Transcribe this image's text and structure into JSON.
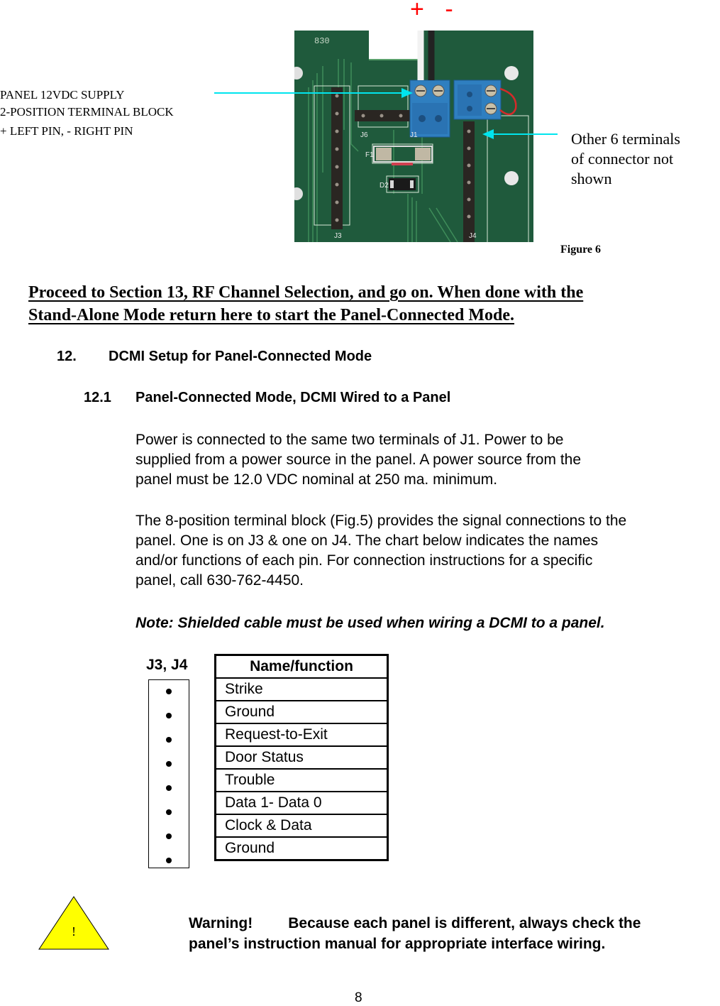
{
  "figure": {
    "polarity_plus": "+",
    "polarity_minus": "-",
    "callout_left": [
      "PANEL 12VDC SUPPLY",
      "2-POSITION TERMINAL BLOCK",
      "+ LEFT PIN, - RIGHT PIN"
    ],
    "callout_right": [
      "Other 6 terminals",
      "of connector not",
      "shown"
    ],
    "caption": "Figure 6",
    "board_labels": {
      "j3": "J3",
      "j4": "J4",
      "j6": "J6",
      "j1": "J1",
      "f1": "F1",
      "d2": "D2",
      "board_id": "830"
    },
    "colors": {
      "arrow": "#00e5ee",
      "polarity": "#ff0000",
      "board": "#1f5a3c",
      "terminal_block": "#2f7fc0"
    }
  },
  "proceed_notice": {
    "line1": "Proceed to Section 13, RF Channel Selection, and go on. When done with the",
    "line2": "Stand-Alone Mode return here to start the Panel-Connected Mode."
  },
  "section_12": {
    "number": "12.",
    "title": "DCMI Setup for Panel-Connected Mode"
  },
  "section_12_1": {
    "number": "12.1",
    "title": "Panel-Connected Mode, DCMI Wired to a Panel",
    "paragraph1": [
      "Power is connected to the same two terminals of J1.  Power to be",
      "supplied from a power source in the panel.  A power source from the",
      "panel must be 12.0 VDC nominal at 250 ma. minimum."
    ],
    "paragraph2": [
      "The 8-position terminal block (Fig.5) provides the signal connections to the",
      "panel.  One is on J3 & one on J4.  The chart below indicates the names",
      "and/or functions of each pin.  For connection instructions for a specific",
      "panel, call 630-762-4450."
    ],
    "note": "Note:  Shielded cable must be used when wiring a DCMI to a panel."
  },
  "pin_table": {
    "connector_label": "J3, J4",
    "header": "Name/function",
    "pins": [
      "Strike",
      "Ground",
      "Request-to-Exit",
      "Door Status",
      "Trouble",
      "Data 1- Data 0",
      "Clock & Data",
      "Ground"
    ]
  },
  "warning": {
    "icon": "warning-triangle-icon",
    "icon_glyph": "!",
    "icon_color": "#ffff00",
    "label": "Warning!",
    "line1": "Because each panel is different, always check the",
    "line2": "panel’s instruction manual for appropriate interface wiring."
  },
  "page_number": "8"
}
